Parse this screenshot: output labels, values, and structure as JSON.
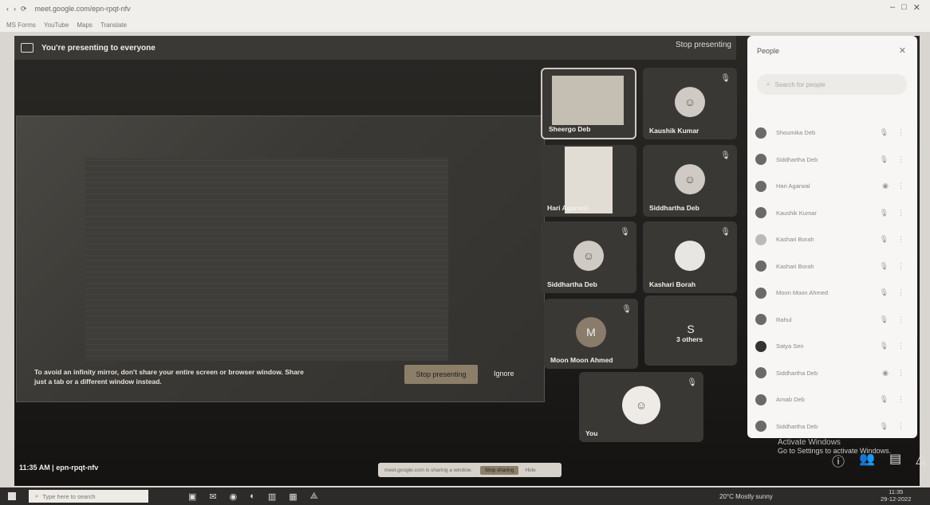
{
  "browser": {
    "url": "meet.google.com/epn-rpqt-nfv",
    "bookmarks": [
      "MS Forms",
      "YouTube",
      "Maps",
      "Translate"
    ],
    "right_icons": [
      "minimize",
      "maximize",
      "close"
    ]
  },
  "banner": {
    "text": "You're presenting to everyone",
    "stop": "Stop presenting"
  },
  "shared": {
    "message": "To avoid an infinity mirror, don't share your entire screen or browser window. Share just a tab or a different window instead.",
    "stop_button": "Stop presenting",
    "ignore_button": "Ignore"
  },
  "tiles": [
    {
      "name": "Sheergo Deb",
      "type": "video"
    },
    {
      "name": "Kaushik Kumar",
      "type": "avatar"
    },
    {
      "name": "Hari Agarwal",
      "type": "video"
    },
    {
      "name": "Siddhartha Deb",
      "type": "avatar"
    },
    {
      "name": "Siddhartha Deb",
      "type": "avatar"
    },
    {
      "name": "Kashari Borah",
      "type": "avatar"
    },
    {
      "name": "Moon Moon Ahmed",
      "type": "initial",
      "initial": "M"
    },
    {
      "name": "3 others",
      "type": "others",
      "initial": "S"
    },
    {
      "name": "You",
      "type": "avatar"
    }
  ],
  "people_panel": {
    "title": "People",
    "search_placeholder": "Search for people",
    "people": [
      "Shoumika Deb",
      "Siddhartha Deb",
      "Hari Agarwal",
      "Kaushik Kumar",
      "Kashari Borah",
      "Kashari Borah",
      "Moon Moon Ahmed",
      "Rahul",
      "Satya Sen",
      "Siddhartha Deb",
      "Arnab Deb",
      "Siddhartha Deb"
    ]
  },
  "activation": {
    "line1": "Activate Windows",
    "line2": "Go to Settings to activate Windows."
  },
  "meeting": {
    "time_code": "11:35 AM | epn-rpqt-nfv"
  },
  "toast": {
    "text": "meet.google.com is sharing a window.",
    "stop": "Stop sharing",
    "hide": "Hide"
  },
  "taskbar": {
    "search_placeholder": "Type here to search",
    "weather": "20°C Mostly sunny",
    "time": "11:35",
    "date": "29-12-2022"
  }
}
